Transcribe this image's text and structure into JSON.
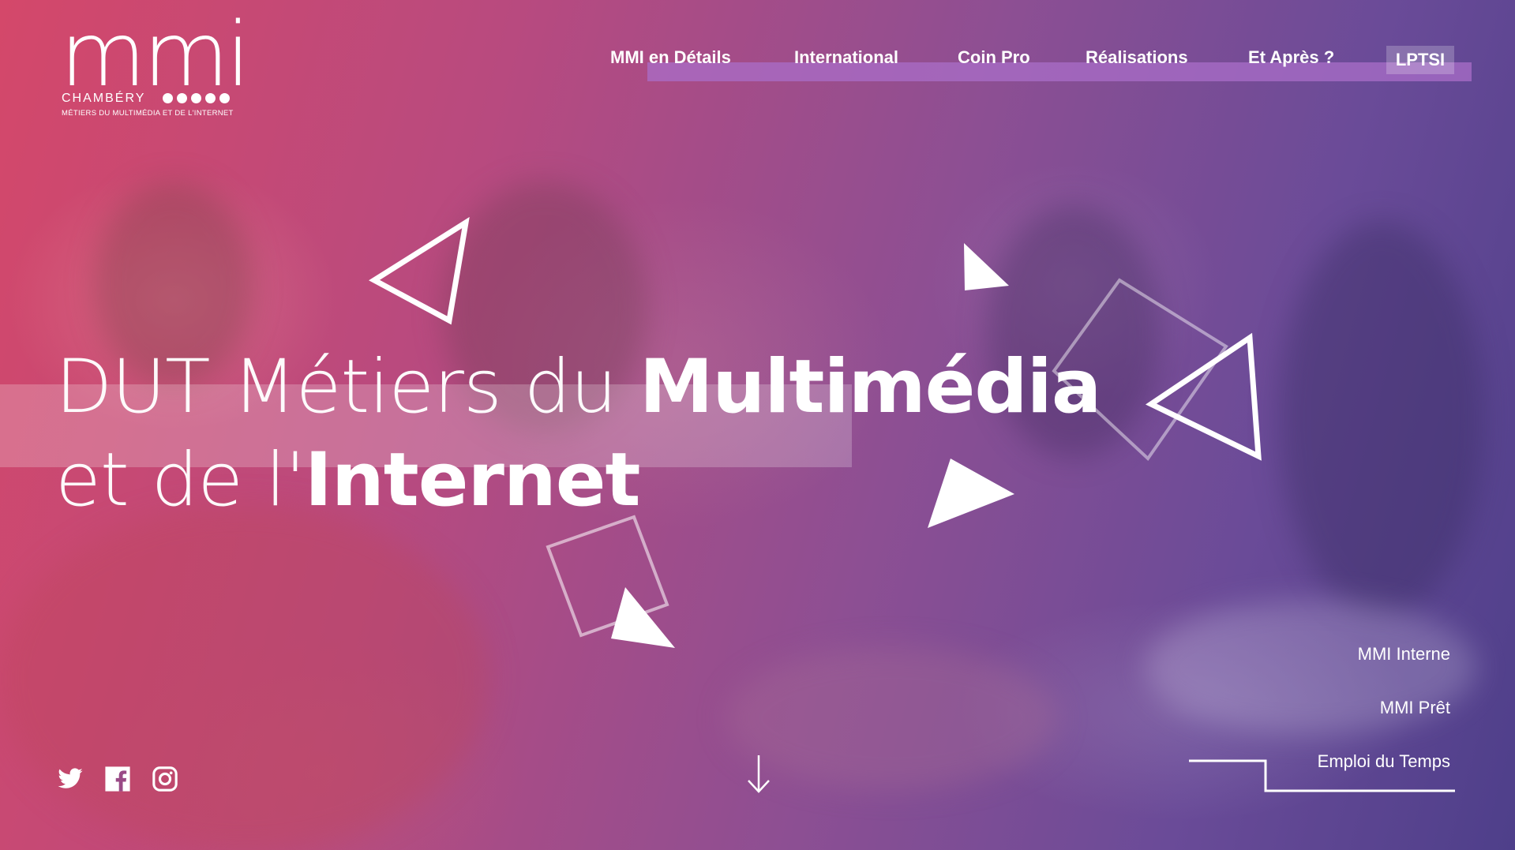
{
  "logo": {
    "mark": "mmi",
    "city": "CHAMBÉRY",
    "tagline": "MÉTIERS DU MULTIMÉDIA ET DE L'INTERNET"
  },
  "nav": {
    "items": [
      {
        "label": "MMI en Détails"
      },
      {
        "label": "International"
      },
      {
        "label": "Coin Pro"
      },
      {
        "label": "Réalisations"
      },
      {
        "label": "Et Après ?"
      }
    ],
    "cta": "LPTSI"
  },
  "headline": {
    "line1_light": "DUT Métiers du ",
    "line1_bold": "Multimédia",
    "line2_light": "et de l'",
    "line2_bold": "Internet"
  },
  "social": [
    {
      "icon": "twitter-icon"
    },
    {
      "icon": "facebook-icon"
    },
    {
      "icon": "instagram-icon"
    }
  ],
  "scroll": {
    "icon": "arrow-down-icon"
  },
  "side_links": {
    "internal": "MMI Interne",
    "loan": "MMI Prêt",
    "schedule": "Emploi du Temps"
  },
  "colors": {
    "gradient_left": "#d4486a",
    "gradient_mid": "#8d4f93",
    "gradient_right": "#4e3f8a",
    "nav_band": "#aa6ec8",
    "text": "#ffffff"
  }
}
